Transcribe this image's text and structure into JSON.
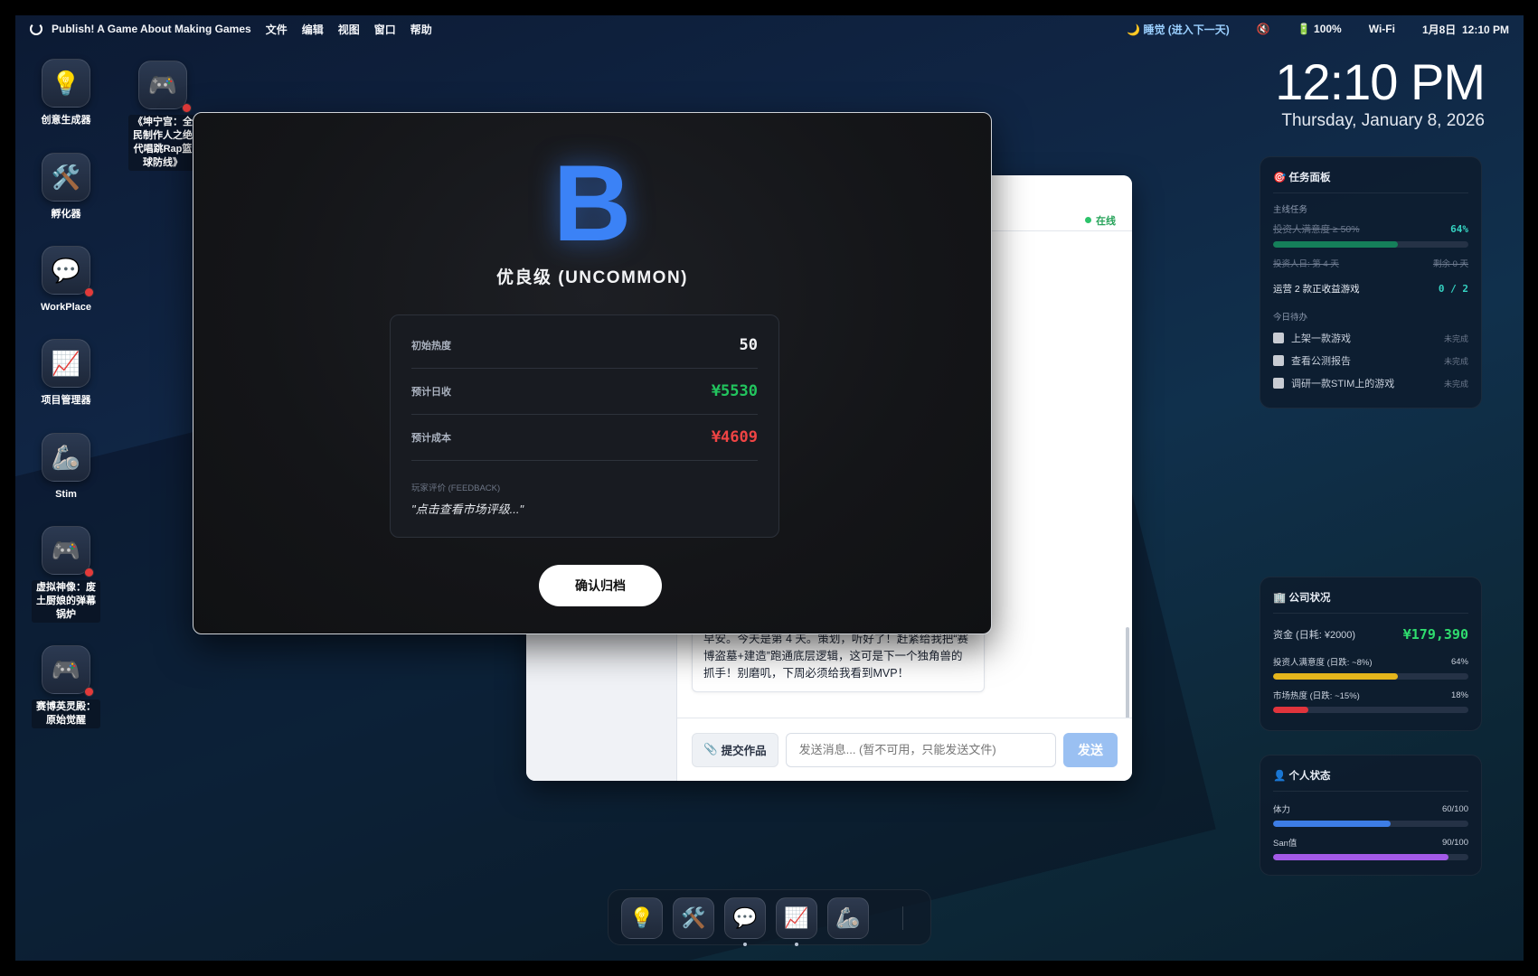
{
  "menubar": {
    "app_name": "Publish! A Game About Making Games",
    "menus": [
      "文件",
      "编辑",
      "视图",
      "窗口",
      "帮助"
    ],
    "sleep": "🌙 睡觉 (进入下一天)",
    "mute_icon": "🔇",
    "battery": "🔋 100%",
    "wifi": "Wi-Fi",
    "date": "1月8日",
    "time": "12:10 PM"
  },
  "desktop_icons": [
    {
      "label": "创意生成器",
      "icon": "💡",
      "badge": false
    },
    {
      "label": "孵化器",
      "icon": "🛠️",
      "badge": false
    },
    {
      "label": "WorkPlace",
      "icon": "💬",
      "badge": true
    },
    {
      "label": "项目管理器",
      "icon": "📈",
      "badge": false
    },
    {
      "label": "Stim",
      "icon": "🦾",
      "badge": false
    },
    {
      "label": "虚拟神像：废土厨娘的弹幕锅炉",
      "icon": "🎮",
      "badge": true
    },
    {
      "label": "赛博英灵殿：原始觉醒",
      "icon": "🎮",
      "badge": true
    },
    {
      "label": "《坤宁宫：全民制作人之绝代唱跳Rap篮球防线》",
      "icon": "🎮",
      "badge": true
    }
  ],
  "clock": {
    "time": "12:10 PM",
    "date": "Thursday, January 8, 2026"
  },
  "task_panel": {
    "title": "🎯 任务面板",
    "main_label": "主线任务",
    "task1_label": "投资人满意度 ≥ 50%",
    "task1_value": "64%",
    "task1_progress": 0.64,
    "task2_label": "投资人日: 第 4 天",
    "task2_value": "剩余 0 天",
    "task3_label": "运营 2 款正收益游戏",
    "task3_value": "0 / 2",
    "today_label": "今日待办",
    "todos": [
      {
        "label": "上架一款游戏",
        "status": "未完成"
      },
      {
        "label": "查看公测报告",
        "status": "未完成"
      },
      {
        "label": "调研一款STIM上的游戏",
        "status": "未完成"
      }
    ]
  },
  "company": {
    "title": "🏢 公司状况",
    "funds_label": "资金 (日耗: ¥2000)",
    "funds_value": "¥179,390",
    "investor_label": "投资人满意度 (日跌: ~8%)",
    "investor_value": "64%",
    "investor_progress": 0.64,
    "market_label": "市场热度 (日跌: ~15%)",
    "market_value": "18%",
    "market_progress": 0.18
  },
  "personal": {
    "title": "👤 个人状态",
    "stamina_label": "体力",
    "stamina_value": "60/100",
    "stamina_progress": 0.6,
    "san_label": "San值",
    "san_value": "90/100",
    "san_progress": 0.9
  },
  "chat": {
    "status": "在线",
    "message": "早安。今天是第 4 天。策划，听好了！赶紧给我把“赛博盗墓+建造”跑通底层逻辑，这可是下一个独角兽的抓手！别磨叽，下周必须给我看到MVP！",
    "submit_label": "提交作品",
    "input_placeholder": "发送消息... (暂不可用，只能发送文件)",
    "send_label": "发送"
  },
  "modal": {
    "grade": "B",
    "rarity": "优良级 (UNCOMMON)",
    "heat_label": "初始热度",
    "heat_value": "50",
    "revenue_label": "预计日收",
    "revenue_value": "¥5530",
    "cost_label": "预计成本",
    "cost_value": "¥4609",
    "feedback_label": "玩家评价 (FEEDBACK)",
    "feedback_text": "\"点击查看市场评级...\"",
    "confirm_label": "确认归档"
  },
  "dock": {
    "items": [
      "💡",
      "🛠️",
      "💬",
      "📈",
      "🦾"
    ]
  },
  "colors": {
    "accent_blue": "#3b82f6",
    "positive": "#22c55e",
    "negative": "#ef4444",
    "teal_bar": "#15805a",
    "gold_bar": "#e4b51c",
    "red_bar": "#e0343c",
    "blue_bar": "#3d7de6",
    "purple_bar": "#a35ae8"
  }
}
